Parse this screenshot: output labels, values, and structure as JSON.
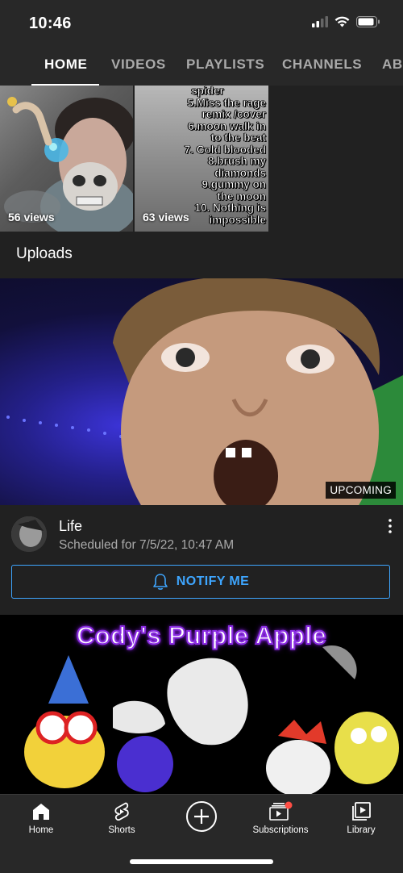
{
  "status_bar": {
    "time": "10:46"
  },
  "tabs": [
    {
      "label": "HOME",
      "active": true
    },
    {
      "label": "VIDEOS",
      "active": false
    },
    {
      "label": "PLAYLISTS",
      "active": false
    },
    {
      "label": "CHANNELS",
      "active": false
    },
    {
      "label": "ABOUT",
      "active": false
    }
  ],
  "shelf": {
    "items": [
      {
        "views": "56 views"
      },
      {
        "views": "63 views",
        "overlay_lines": [
          "spider",
          "5.Miss the rage",
          "remix /cover",
          "6.moon walk in",
          "to the beat",
          "7. Cold blooded",
          "8.brush my",
          "diamonds",
          "9.gummy on",
          "the moon",
          "10. Nothing is",
          "impossible"
        ]
      }
    ]
  },
  "uploads": {
    "title": "Uploads",
    "video1": {
      "badge": "UPCOMING",
      "title": "Life",
      "subtitle": "Scheduled for 7/5/22, 10:47 AM",
      "notify_label": "NOTIFY ME"
    },
    "video2": {
      "overlay_title": "Cody's Purple Apple"
    }
  },
  "bottom_nav": [
    {
      "label": "Home",
      "icon": "home-icon"
    },
    {
      "label": "Shorts",
      "icon": "shorts-icon"
    },
    {
      "label": "",
      "icon": "create-icon"
    },
    {
      "label": "Subscriptions",
      "icon": "subscriptions-icon"
    },
    {
      "label": "Library",
      "icon": "library-icon"
    }
  ],
  "colors": {
    "background": "#212121",
    "accent_blue": "#3ea6ff",
    "notification_red": "#ff4e45"
  }
}
